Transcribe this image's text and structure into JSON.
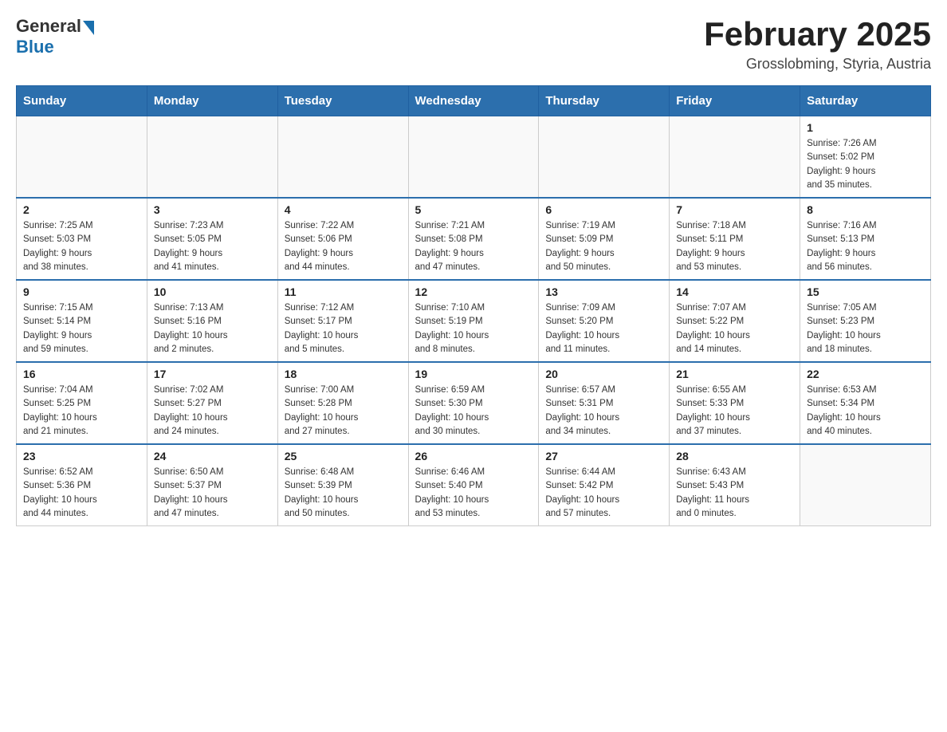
{
  "logo": {
    "general": "General",
    "blue": "Blue"
  },
  "title": "February 2025",
  "subtitle": "Grosslobming, Styria, Austria",
  "days_of_week": [
    "Sunday",
    "Monday",
    "Tuesday",
    "Wednesday",
    "Thursday",
    "Friday",
    "Saturday"
  ],
  "weeks": [
    [
      {
        "day": "",
        "info": ""
      },
      {
        "day": "",
        "info": ""
      },
      {
        "day": "",
        "info": ""
      },
      {
        "day": "",
        "info": ""
      },
      {
        "day": "",
        "info": ""
      },
      {
        "day": "",
        "info": ""
      },
      {
        "day": "1",
        "info": "Sunrise: 7:26 AM\nSunset: 5:02 PM\nDaylight: 9 hours\nand 35 minutes."
      }
    ],
    [
      {
        "day": "2",
        "info": "Sunrise: 7:25 AM\nSunset: 5:03 PM\nDaylight: 9 hours\nand 38 minutes."
      },
      {
        "day": "3",
        "info": "Sunrise: 7:23 AM\nSunset: 5:05 PM\nDaylight: 9 hours\nand 41 minutes."
      },
      {
        "day": "4",
        "info": "Sunrise: 7:22 AM\nSunset: 5:06 PM\nDaylight: 9 hours\nand 44 minutes."
      },
      {
        "day": "5",
        "info": "Sunrise: 7:21 AM\nSunset: 5:08 PM\nDaylight: 9 hours\nand 47 minutes."
      },
      {
        "day": "6",
        "info": "Sunrise: 7:19 AM\nSunset: 5:09 PM\nDaylight: 9 hours\nand 50 minutes."
      },
      {
        "day": "7",
        "info": "Sunrise: 7:18 AM\nSunset: 5:11 PM\nDaylight: 9 hours\nand 53 minutes."
      },
      {
        "day": "8",
        "info": "Sunrise: 7:16 AM\nSunset: 5:13 PM\nDaylight: 9 hours\nand 56 minutes."
      }
    ],
    [
      {
        "day": "9",
        "info": "Sunrise: 7:15 AM\nSunset: 5:14 PM\nDaylight: 9 hours\nand 59 minutes."
      },
      {
        "day": "10",
        "info": "Sunrise: 7:13 AM\nSunset: 5:16 PM\nDaylight: 10 hours\nand 2 minutes."
      },
      {
        "day": "11",
        "info": "Sunrise: 7:12 AM\nSunset: 5:17 PM\nDaylight: 10 hours\nand 5 minutes."
      },
      {
        "day": "12",
        "info": "Sunrise: 7:10 AM\nSunset: 5:19 PM\nDaylight: 10 hours\nand 8 minutes."
      },
      {
        "day": "13",
        "info": "Sunrise: 7:09 AM\nSunset: 5:20 PM\nDaylight: 10 hours\nand 11 minutes."
      },
      {
        "day": "14",
        "info": "Sunrise: 7:07 AM\nSunset: 5:22 PM\nDaylight: 10 hours\nand 14 minutes."
      },
      {
        "day": "15",
        "info": "Sunrise: 7:05 AM\nSunset: 5:23 PM\nDaylight: 10 hours\nand 18 minutes."
      }
    ],
    [
      {
        "day": "16",
        "info": "Sunrise: 7:04 AM\nSunset: 5:25 PM\nDaylight: 10 hours\nand 21 minutes."
      },
      {
        "day": "17",
        "info": "Sunrise: 7:02 AM\nSunset: 5:27 PM\nDaylight: 10 hours\nand 24 minutes."
      },
      {
        "day": "18",
        "info": "Sunrise: 7:00 AM\nSunset: 5:28 PM\nDaylight: 10 hours\nand 27 minutes."
      },
      {
        "day": "19",
        "info": "Sunrise: 6:59 AM\nSunset: 5:30 PM\nDaylight: 10 hours\nand 30 minutes."
      },
      {
        "day": "20",
        "info": "Sunrise: 6:57 AM\nSunset: 5:31 PM\nDaylight: 10 hours\nand 34 minutes."
      },
      {
        "day": "21",
        "info": "Sunrise: 6:55 AM\nSunset: 5:33 PM\nDaylight: 10 hours\nand 37 minutes."
      },
      {
        "day": "22",
        "info": "Sunrise: 6:53 AM\nSunset: 5:34 PM\nDaylight: 10 hours\nand 40 minutes."
      }
    ],
    [
      {
        "day": "23",
        "info": "Sunrise: 6:52 AM\nSunset: 5:36 PM\nDaylight: 10 hours\nand 44 minutes."
      },
      {
        "day": "24",
        "info": "Sunrise: 6:50 AM\nSunset: 5:37 PM\nDaylight: 10 hours\nand 47 minutes."
      },
      {
        "day": "25",
        "info": "Sunrise: 6:48 AM\nSunset: 5:39 PM\nDaylight: 10 hours\nand 50 minutes."
      },
      {
        "day": "26",
        "info": "Sunrise: 6:46 AM\nSunset: 5:40 PM\nDaylight: 10 hours\nand 53 minutes."
      },
      {
        "day": "27",
        "info": "Sunrise: 6:44 AM\nSunset: 5:42 PM\nDaylight: 10 hours\nand 57 minutes."
      },
      {
        "day": "28",
        "info": "Sunrise: 6:43 AM\nSunset: 5:43 PM\nDaylight: 11 hours\nand 0 minutes."
      },
      {
        "day": "",
        "info": ""
      }
    ]
  ]
}
